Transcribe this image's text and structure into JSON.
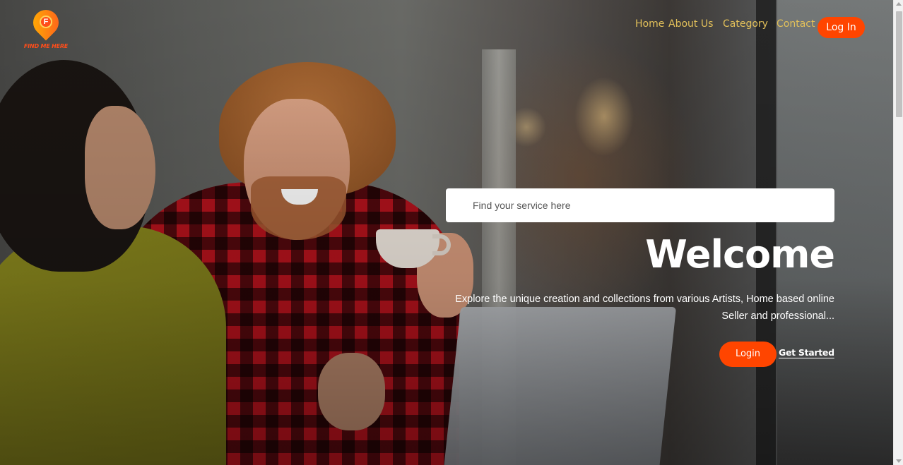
{
  "brand": {
    "logo_letter": "F",
    "logo_text": "FIND ME HERE",
    "accent_color": "#ff4500",
    "nav_text_color": "#e2c05a"
  },
  "nav": {
    "home": "Home",
    "about": "About Us",
    "category": "Category",
    "contact": "Contact",
    "login": "Log In"
  },
  "hero": {
    "search_placeholder": "Find your service here",
    "title": "Welcome",
    "description": "Explore the unique creation and collections from various Artists, Home based online Seller and professional...",
    "login_button": "Login",
    "get_started_link": "Get Started",
    "background_image": "photo of a man in a red plaid shirt holding a coffee cup smiling at a woman in a cafe"
  }
}
